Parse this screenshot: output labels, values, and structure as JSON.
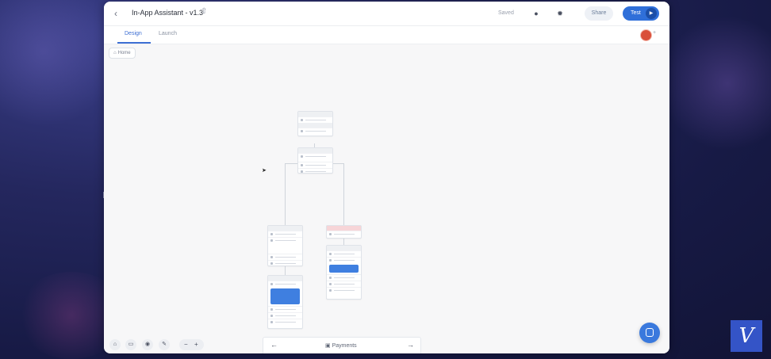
{
  "window": {
    "title": "In-App Assistant - v1.3",
    "status": "Saved",
    "share_label": "Share",
    "test_label": "Test"
  },
  "tabs": [
    {
      "label": "Design",
      "active": true
    },
    {
      "label": "Launch",
      "active": false
    }
  ],
  "canvas": {
    "home_label": "Home"
  },
  "bottom_toolbar": {
    "zoom_out": "−",
    "zoom_in": "+"
  },
  "pager": {
    "page_name": "Payments",
    "prev_icon": "arrow-left-icon",
    "next_icon": "arrow-right-icon"
  },
  "icons": {
    "back": "chevron-left-icon",
    "upload": "upload-icon",
    "info": "info-icon",
    "settings": "gear-icon",
    "play": "play-icon",
    "chat": "chat-icon",
    "home": "home-icon"
  },
  "brand": {
    "logo_text": "V",
    "accent": "#2f6fd9"
  }
}
